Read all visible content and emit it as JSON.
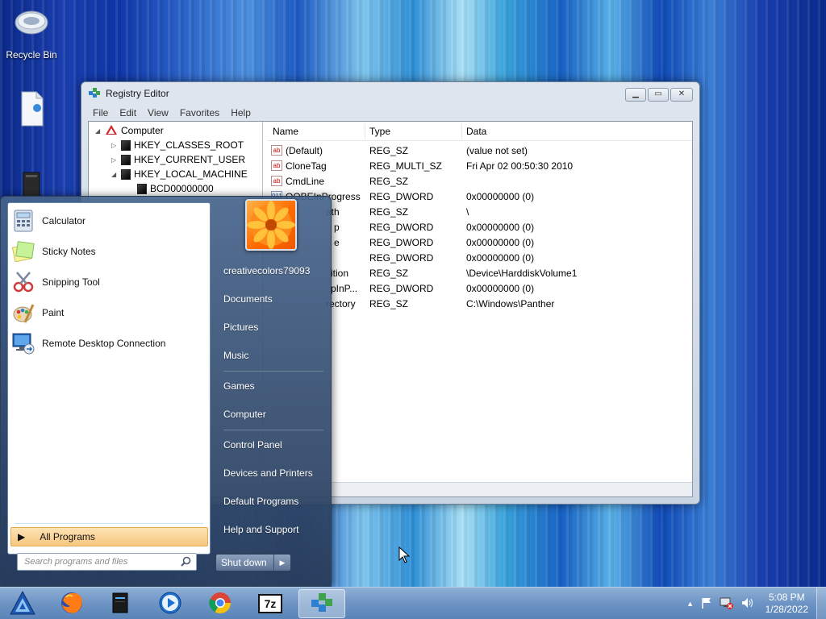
{
  "desktop": {
    "icons": [
      {
        "label": "Recycle Bin",
        "icon": "recycle-bin-icon"
      },
      {
        "label": "",
        "icon": "document-shortcut-icon"
      },
      {
        "label": "",
        "icon": "computer-tower-icon"
      }
    ]
  },
  "regedit": {
    "title": "Registry Editor",
    "menu": [
      "File",
      "Edit",
      "View",
      "Favorites",
      "Help"
    ],
    "tree": [
      {
        "label": "Computer",
        "icon": "computer-icon"
      },
      {
        "label": "HKEY_CLASSES_ROOT",
        "icon": "folder-icon"
      },
      {
        "label": "HKEY_CURRENT_USER",
        "icon": "folder-icon"
      },
      {
        "label": "HKEY_LOCAL_MACHINE",
        "icon": "folder-icon"
      },
      {
        "label": "BCD00000000",
        "icon": "folder-icon"
      }
    ],
    "columns": {
      "name": "Name",
      "type": "Type",
      "data": "Data"
    },
    "rows": [
      {
        "name": "(Default)",
        "type": "REG_SZ",
        "data": "(value not set)"
      },
      {
        "name": "CloneTag",
        "type": "REG_MULTI_SZ",
        "data": "Fri Apr 02 00:50:30 2010"
      },
      {
        "name": "CmdLine",
        "type": "REG_SZ",
        "data": ""
      },
      {
        "name": "OOBEInProgress",
        "type": "REG_DWORD",
        "data": "0x00000000 (0)"
      },
      {
        "name": "ath",
        "type": "REG_SZ",
        "data": "\\"
      },
      {
        "name": "p",
        "type": "REG_DWORD",
        "data": "0x00000000 (0)"
      },
      {
        "name": "e",
        "type": "REG_DWORD",
        "data": "0x00000000 (0)"
      },
      {
        "name": "",
        "type": "REG_DWORD",
        "data": "0x00000000 (0)"
      },
      {
        "name": "ition",
        "type": "REG_SZ",
        "data": "\\Device\\HarddiskVolume1"
      },
      {
        "name": "pInP...",
        "type": "REG_DWORD",
        "data": "0x00000000 (0)"
      },
      {
        "name": "rectory",
        "type": "REG_SZ",
        "data": "C:\\Windows\\Panther"
      }
    ]
  },
  "startmenu": {
    "programs": [
      {
        "label": "Calculator",
        "icon": "calculator-icon"
      },
      {
        "label": "Sticky Notes",
        "icon": "sticky-notes-icon"
      },
      {
        "label": "Snipping Tool",
        "icon": "snipping-tool-icon"
      },
      {
        "label": "Paint",
        "icon": "paint-icon"
      },
      {
        "label": "Remote Desktop Connection",
        "icon": "remote-desktop-icon"
      }
    ],
    "all_programs": "All Programs",
    "search_placeholder": "Search programs and files",
    "username": "creativecolors79093",
    "right_links": [
      "Documents",
      "Pictures",
      "Music",
      "Games",
      "Computer",
      "Control Panel",
      "Devices and Printers",
      "Default Programs",
      "Help and Support"
    ],
    "shutdown": "Shut down"
  },
  "taskbar": {
    "apps": [
      "start-orb-icon",
      "firefox-icon",
      "drive-icon",
      "media-player-icon",
      "chrome-icon",
      "7zip-icon",
      "regedit-icon"
    ],
    "sevenzip_label": "7z",
    "time": "5:08 PM",
    "date": "1/28/2022"
  }
}
